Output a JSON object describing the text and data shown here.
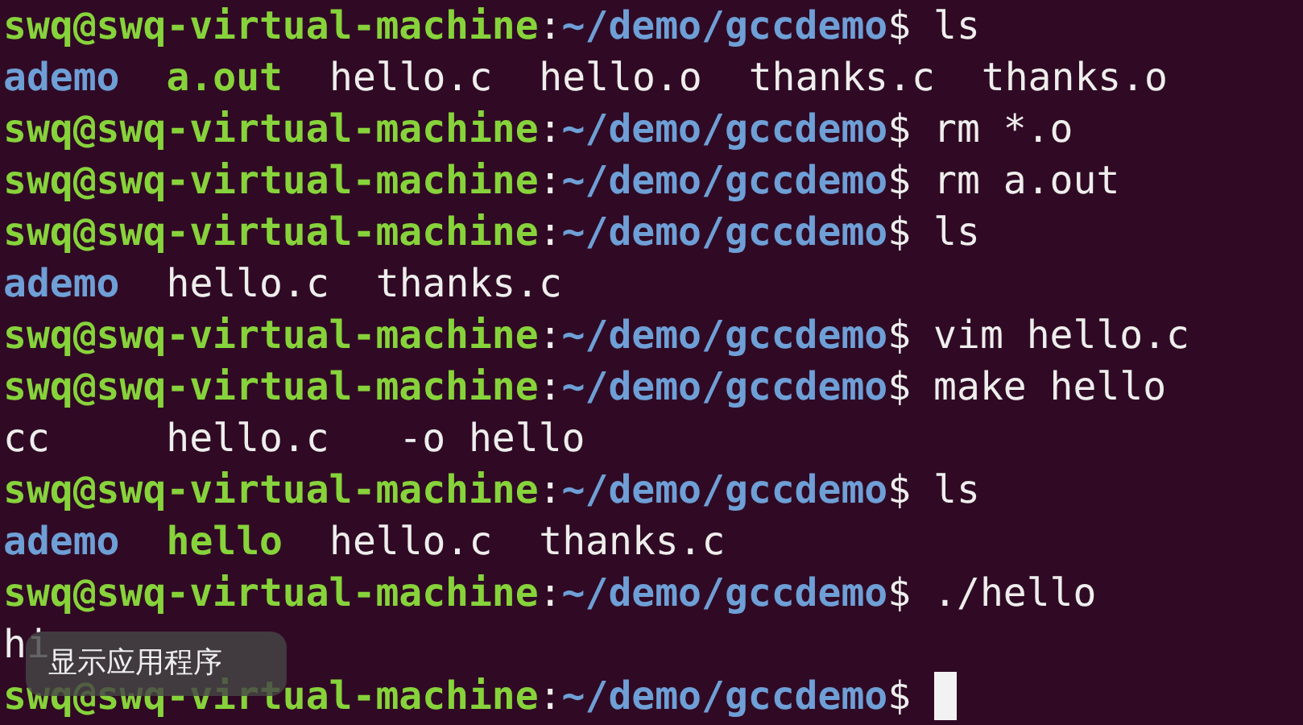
{
  "terminal": {
    "lines": [
      {
        "kind": "prompt",
        "user": "swq@swq-virtual-machine",
        "separator": ":",
        "path": "~/demo/gccdemo",
        "symbol": "$",
        "command": "ls"
      },
      {
        "kind": "listing",
        "items": [
          {
            "text": "ademo",
            "color": "#6e9fd6",
            "bold": true
          },
          {
            "text": "a.out",
            "color": "#87d33b",
            "bold": true
          },
          {
            "text": "hello.c",
            "color": "#eeeeec",
            "bold": false
          },
          {
            "text": "hello.o",
            "color": "#eeeeec",
            "bold": false
          },
          {
            "text": "thanks.c",
            "color": "#eeeeec",
            "bold": false
          },
          {
            "text": "thanks.o",
            "color": "#eeeeec",
            "bold": false
          }
        ]
      },
      {
        "kind": "prompt",
        "user": "swq@swq-virtual-machine",
        "separator": ":",
        "path": "~/demo/gccdemo",
        "symbol": "$",
        "command": "rm *.o"
      },
      {
        "kind": "prompt",
        "user": "swq@swq-virtual-machine",
        "separator": ":",
        "path": "~/demo/gccdemo",
        "symbol": "$",
        "command": "rm a.out"
      },
      {
        "kind": "prompt",
        "user": "swq@swq-virtual-machine",
        "separator": ":",
        "path": "~/demo/gccdemo",
        "symbol": "$",
        "command": "ls"
      },
      {
        "kind": "listing",
        "items": [
          {
            "text": "ademo",
            "color": "#6e9fd6",
            "bold": true
          },
          {
            "text": "hello.c",
            "color": "#eeeeec",
            "bold": false
          },
          {
            "text": "thanks.c",
            "color": "#eeeeec",
            "bold": false
          }
        ]
      },
      {
        "kind": "prompt",
        "user": "swq@swq-virtual-machine",
        "separator": ":",
        "path": "~/demo/gccdemo",
        "symbol": "$",
        "command": "vim hello.c"
      },
      {
        "kind": "prompt",
        "user": "swq@swq-virtual-machine",
        "separator": ":",
        "path": "~/demo/gccdemo",
        "symbol": "$",
        "command": "make hello"
      },
      {
        "kind": "output",
        "text": "cc     hello.c   -o hello"
      },
      {
        "kind": "prompt",
        "user": "swq@swq-virtual-machine",
        "separator": ":",
        "path": "~/demo/gccdemo",
        "symbol": "$",
        "command": "ls"
      },
      {
        "kind": "listing",
        "items": [
          {
            "text": "ademo",
            "color": "#6e9fd6",
            "bold": true
          },
          {
            "text": "hello",
            "color": "#87d33b",
            "bold": true
          },
          {
            "text": "hello.c",
            "color": "#eeeeec",
            "bold": false
          },
          {
            "text": "thanks.c",
            "color": "#eeeeec",
            "bold": false
          }
        ]
      },
      {
        "kind": "prompt",
        "user": "swq@swq-virtual-machine",
        "separator": ":",
        "path": "~/demo/gccdemo",
        "symbol": "$",
        "command": "./hello"
      },
      {
        "kind": "output",
        "text": "hi"
      },
      {
        "kind": "prompt",
        "user": "swq@swq-virtual-machine",
        "separator": ":",
        "path": "~/demo/gccdemo",
        "symbol": "$",
        "cursor": true
      }
    ]
  },
  "tooltip": {
    "text": "显示应用程序"
  }
}
